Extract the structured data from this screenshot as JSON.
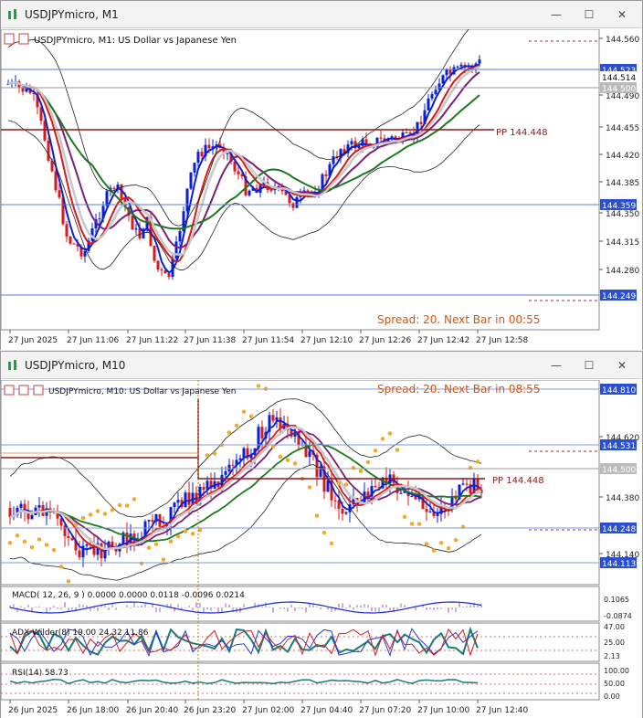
{
  "top": {
    "title": "USDJPYmicro, M1",
    "header": "USDJPYmicro, M1:  US Dollar vs Japanese Yen",
    "spread_text": "Spread: 20. Next Bar in 00:55",
    "pp_label": "PP 144.448",
    "y_ticks": [
      "144.560",
      "144.490",
      "144.455",
      "144.420",
      "144.385",
      "144.350",
      "144.315",
      "144.280"
    ],
    "price_tags": [
      "144.523",
      "144.514",
      "144.500",
      "144.359",
      "144.249"
    ],
    "x_ticks": [
      "27 Jun 2025",
      "27 Jun 11:06",
      "27 Jun 11:22",
      "27 Jun 11:38",
      "27 Jun 11:54",
      "27 Jun 12:10",
      "27 Jun 12:26",
      "27 Jun 12:42",
      "27 Jun 12:58"
    ]
  },
  "bottom": {
    "title": "USDJPYmicro, M10",
    "header": "USDJPYmicro, M10:  US Dollar vs Japanese Yen",
    "spread_text": "Spread: 20. Next Bar in 08:55",
    "pp_label": "PP 144.448",
    "y_ticks": [
      "144.620",
      "144.380",
      "144.140"
    ],
    "price_tags": [
      "144.810",
      "144.531",
      "144.500",
      "144.248",
      "144.113"
    ],
    "macd_label": "MACD( 12, 26, 9 ) 0.0000 0.0000 0.0118 -0.0096 0.0214",
    "macd_ticks": [
      "0.1065",
      "-0.0874"
    ],
    "adx_label": "ADX Wilder(8) 19.00 24.32 11.86",
    "adx_ticks": [
      "47.00",
      "25.00",
      "2.13"
    ],
    "rsi_label": "RSI(14) 58.73",
    "rsi_ticks": [
      "100.00",
      "50.00",
      "0.00"
    ],
    "x_ticks": [
      "26 Jun 2025",
      "26 Jun 18:00",
      "26 Jun 20:40",
      "26 Jun 23:20",
      "27 Jun 02:00",
      "27 Jun 04:40",
      "27 Jun 07:20",
      "27 Jun 10:00",
      "27 Jun 12:40"
    ]
  },
  "window_buttons": {
    "minimize": "—",
    "maximize": "☐",
    "close": "✕"
  },
  "colors": {
    "bull": "#0a1fd6",
    "bear": "#d81a1a",
    "pp": "#8b1a1a",
    "spread": "#d9540a",
    "sar": "#f5a623",
    "green_ma": "#1c7a1c",
    "purple_ma": "#7a1f7a"
  }
}
